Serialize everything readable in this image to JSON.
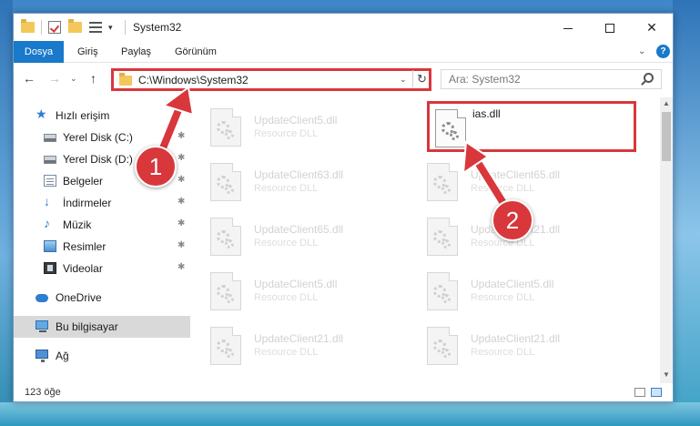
{
  "window": {
    "title": "System32",
    "quick_access_dropdown": "▾",
    "minimize": "",
    "maximize": "",
    "close": "✕"
  },
  "ribbon": {
    "tabs": [
      "Dosya",
      "Giriş",
      "Paylaş",
      "Görünüm"
    ],
    "expand": "⌄",
    "help": "?"
  },
  "nav": {
    "back": "←",
    "forward": "→",
    "recent": "⌄",
    "up": "↑",
    "address": "C:\\Windows\\System32",
    "address_dropdown": "⌄",
    "refresh": "↻",
    "search_placeholder": "Ara: System32"
  },
  "sidebar": {
    "items": [
      {
        "label": "Hızlı erişim",
        "icon": "star-icon",
        "pinned": false
      },
      {
        "label": "Yerel Disk (C:)",
        "icon": "disk-icon",
        "pinned": true
      },
      {
        "label": "Yerel Disk (D:)",
        "icon": "disk-icon",
        "pinned": true
      },
      {
        "label": "Belgeler",
        "icon": "documents-icon",
        "pinned": true
      },
      {
        "label": "İndirmeler",
        "icon": "download-icon",
        "pinned": true
      },
      {
        "label": "Müzik",
        "icon": "music-icon",
        "pinned": true
      },
      {
        "label": "Resimler",
        "icon": "pictures-icon",
        "pinned": true
      },
      {
        "label": "Videolar",
        "icon": "videos-icon",
        "pinned": true
      },
      {
        "label": "OneDrive",
        "icon": "cloud-icon",
        "pinned": false
      },
      {
        "label": "Bu bilgisayar",
        "icon": "computer-icon",
        "pinned": false
      },
      {
        "label": "Ağ",
        "icon": "network-icon",
        "pinned": false
      }
    ],
    "pin_glyph": "📌"
  },
  "files": [
    {
      "name": "UpdateClient5.dll",
      "type": "Resource DLL"
    },
    {
      "name": "ias.dll",
      "type": "",
      "highlighted": true
    },
    {
      "name": "UpdateClient63.dll",
      "type": "Resource DLL"
    },
    {
      "name": "UpdateClient65.dll",
      "type": "Resource DLL"
    },
    {
      "name": "UpdateClient65.dll",
      "type": "Resource DLL"
    },
    {
      "name": "UpdateClient21.dll",
      "type": "Resource DLL"
    },
    {
      "name": "UpdateClient5.dll",
      "type": "Resource DLL"
    },
    {
      "name": "UpdateClient5.dll",
      "type": "Resource DLL"
    },
    {
      "name": "UpdateClient21.dll",
      "type": "Resource DLL"
    },
    {
      "name": "UpdateClient21.dll",
      "type": "Resource DLL"
    }
  ],
  "status": {
    "count": "123 öğe"
  },
  "annotations": {
    "step1": "1",
    "step2": "2",
    "color": "#d8373b"
  },
  "colors": {
    "accent": "#1979ca",
    "highlight": "#d8373b"
  }
}
